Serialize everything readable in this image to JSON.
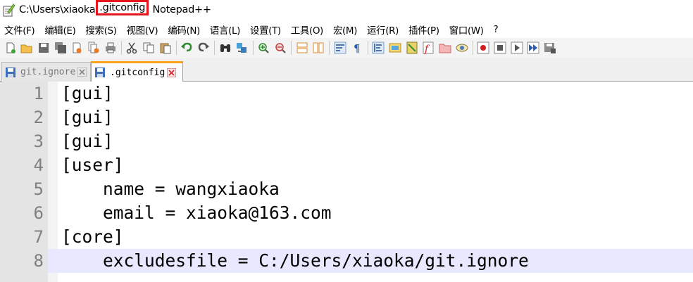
{
  "window": {
    "title_path_prefix": "C:\\Users\\xiaoka",
    "title_highlight": ".gitconfig",
    "title_suffix": "Notepad++"
  },
  "menu": {
    "items": [
      "文件(F)",
      "编辑(E)",
      "搜索(S)",
      "视图(V)",
      "编码(N)",
      "语言(L)",
      "设置(T)",
      "工具(O)",
      "宏(M)",
      "运行(R)",
      "插件(P)",
      "窗口(W)",
      "?"
    ]
  },
  "toolbar": {
    "buttons": [
      "new-file",
      "open-file",
      "save",
      "save-all",
      "close",
      "close-all",
      "print",
      "cut",
      "copy",
      "paste",
      "undo",
      "redo",
      "find",
      "replace",
      "zoom-in",
      "zoom-out",
      "sync-vertical",
      "sync-horizontal",
      "word-wrap",
      "show-all-chars",
      "indent-guide",
      "user-defined-language",
      "document-map",
      "function-list",
      "folder-as-workspace",
      "monitoring",
      "record-macro",
      "stop-recording",
      "play-macro",
      "run-macro-multiple",
      "save-macro"
    ]
  },
  "tabs": [
    {
      "label": "git.ignore",
      "active": false
    },
    {
      "label": ".gitconfig",
      "active": true
    }
  ],
  "editor": {
    "current_line": 8,
    "lines": [
      {
        "number": "1",
        "text": "[gui]"
      },
      {
        "number": "2",
        "text": "[gui]"
      },
      {
        "number": "3",
        "text": "[gui]"
      },
      {
        "number": "4",
        "text": "[user]"
      },
      {
        "number": "5",
        "text": "\tname = wangxiaoka"
      },
      {
        "number": "6",
        "text": "\temail = xiaoka@163.com"
      },
      {
        "number": "7",
        "text": "[core]"
      },
      {
        "number": "8",
        "text": "\texcludesfile = C:/Users/xiaoka/git.ignore"
      }
    ]
  },
  "colors": {
    "highlight_box": "#e8141b",
    "active_tab_accent": "#f9a21b",
    "current_line_bg": "#e8e8ff",
    "gutter_bg": "#e4e4e4",
    "line_number": "#808080"
  }
}
